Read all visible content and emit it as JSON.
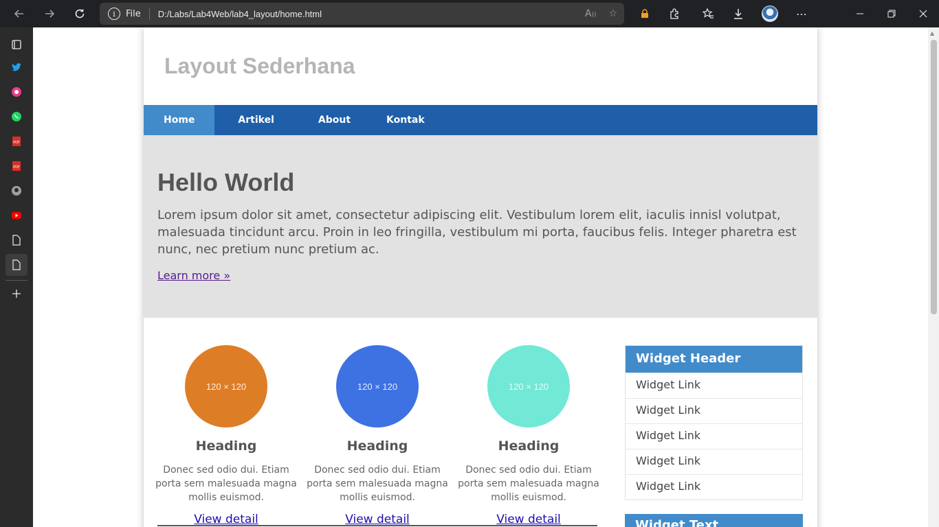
{
  "browser": {
    "address_file_label": "File",
    "url": "D:/Labs/Lab4Web/lab4_layout/home.html"
  },
  "page": {
    "site_title": "Layout Sederhana",
    "menu": [
      {
        "label": "Home",
        "active": true
      },
      {
        "label": "Artikel",
        "active": false
      },
      {
        "label": "About",
        "active": false
      },
      {
        "label": "Kontak",
        "active": false
      }
    ],
    "hero": {
      "heading": "Hello World",
      "text": "Lorem ipsum dolor sit amet, consectetur adipiscing elit. Vestibulum lorem elit, iaculis innisl volutpat, malesuada tincidunt arcu. Proin in leo fringilla, vestibulum mi porta, faucibus felis. Integer pharetra est nunc, nec pretium nunc pretium ac.",
      "link": "Learn more »"
    },
    "columns": [
      {
        "image_label": "120 × 120",
        "color": "#dd7e27",
        "heading": "Heading",
        "text": "Donec sed odio dui. Etiam porta sem malesuada magna mollis euismod.",
        "link": "View detail"
      },
      {
        "image_label": "120 × 120",
        "color": "#3e72e3",
        "heading": "Heading",
        "text": "Donec sed odio dui. Etiam porta sem malesuada magna mollis euismod.",
        "link": "View detail"
      },
      {
        "image_label": "120 × 120",
        "color": "#72e8d6",
        "heading": "Heading",
        "text": "Donec sed odio dui. Etiam porta sem malesuada magna mollis euismod.",
        "link": "View detail"
      }
    ],
    "widget": {
      "header": "Widget Header",
      "links": [
        "Widget Link",
        "Widget Link",
        "Widget Link",
        "Widget Link",
        "Widget Link"
      ]
    },
    "widget2_header": "Widget Text"
  },
  "colors": {
    "menu_bg": "#1f5faa",
    "menu_active": "#428bca",
    "hero_bg": "#e2e2e2",
    "widget_header": "#428bca"
  }
}
